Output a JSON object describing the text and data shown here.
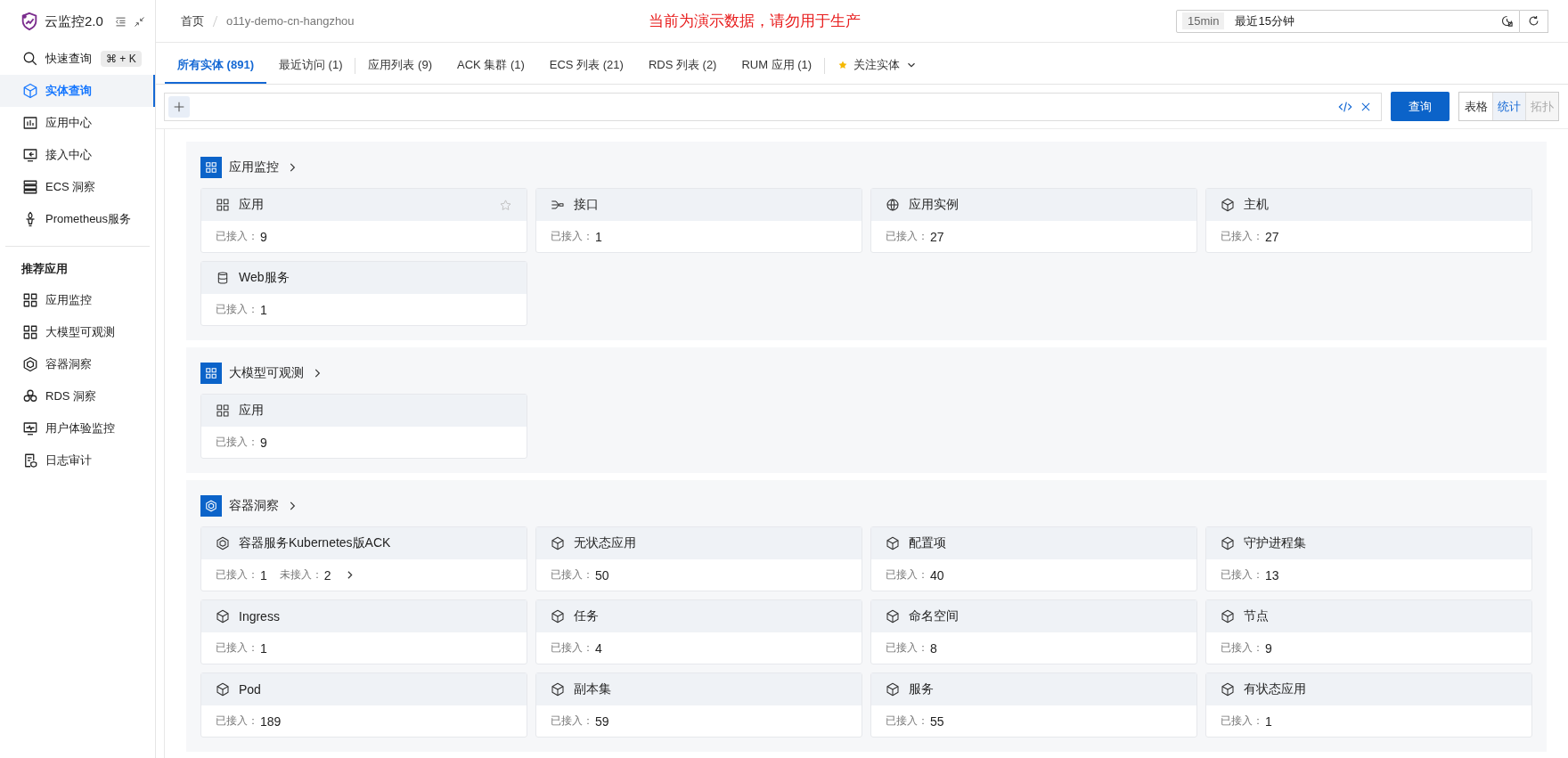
{
  "sidebar": {
    "logo_text": "云监控2.0",
    "items": [
      {
        "label": "快速查询",
        "kind": "search",
        "shortcut": "⌘ + K",
        "selected": false
      },
      {
        "label": "实体查询",
        "kind": "cube",
        "selected": true
      },
      {
        "label": "应用中心",
        "kind": "chart",
        "selected": false
      },
      {
        "label": "接入中心",
        "kind": "monitor-in",
        "selected": false
      },
      {
        "label": "ECS 洞察",
        "kind": "server",
        "selected": false
      },
      {
        "label": "Prometheus服务",
        "kind": "torch",
        "selected": false
      }
    ],
    "group_title": "推荐应用",
    "recommended": [
      {
        "label": "应用监控",
        "kind": "grid",
        "selected": false
      },
      {
        "label": "大模型可观测",
        "kind": "grid",
        "selected": false
      },
      {
        "label": "容器洞察",
        "kind": "hexagon",
        "selected": false
      },
      {
        "label": "RDS 洞察",
        "kind": "trio",
        "selected": false
      },
      {
        "label": "用户体验监控",
        "kind": "pulse-monitor",
        "selected": false
      },
      {
        "label": "日志审计",
        "kind": "log",
        "selected": false
      }
    ]
  },
  "breadcrumb": [
    "首页",
    "o11y-demo-cn-hangzhou"
  ],
  "notice": "当前为演示数据，请勿用于生产",
  "time_range": {
    "badge": "15min",
    "label": "最近15分钟"
  },
  "tabs": [
    {
      "label": "所有实体 (891)",
      "selected": true,
      "separator_before": false,
      "kind": "tab"
    },
    {
      "label": "最近访问 (1)",
      "selected": false,
      "separator_before": false,
      "kind": "tab"
    },
    {
      "label": "应用列表 (9)",
      "selected": false,
      "separator_before": true,
      "kind": "tab"
    },
    {
      "label": "ACK 集群 (1)",
      "selected": false,
      "separator_before": false,
      "kind": "tab"
    },
    {
      "label": "ECS 列表 (21)",
      "selected": false,
      "separator_before": false,
      "kind": "tab"
    },
    {
      "label": "RDS 列表 (2)",
      "selected": false,
      "separator_before": false,
      "kind": "tab"
    },
    {
      "label": "RUM 应用 (1)",
      "selected": false,
      "separator_before": false,
      "kind": "tab"
    },
    {
      "label": "关注实体",
      "selected": false,
      "separator_before": true,
      "kind": "favorites"
    }
  ],
  "query_button": "查询",
  "view_toggle": [
    {
      "label": "表格",
      "selected": false,
      "disabled": false
    },
    {
      "label": "统计",
      "selected": true,
      "disabled": false
    },
    {
      "label": "拓扑",
      "selected": false,
      "disabled": true
    }
  ],
  "sections": [
    {
      "title": "应用监控",
      "kind": "grid",
      "cards": [
        {
          "title": "应用",
          "kind": "grid",
          "starred": false,
          "stats": [
            {
              "label": "已接入：",
              "value": "9"
            }
          ]
        },
        {
          "title": "接口",
          "kind": "nodes",
          "stats": [
            {
              "label": "已接入：",
              "value": "1"
            }
          ]
        },
        {
          "title": "应用实例",
          "kind": "globe",
          "stats": [
            {
              "label": "已接入：",
              "value": "27"
            }
          ]
        },
        {
          "title": "主机",
          "kind": "cube",
          "stats": [
            {
              "label": "已接入：",
              "value": "27"
            }
          ]
        },
        {
          "title": "Web服务",
          "kind": "database",
          "stats": [
            {
              "label": "已接入：",
              "value": "1"
            }
          ]
        }
      ]
    },
    {
      "title": "大模型可观测",
      "kind": "grid",
      "cards": [
        {
          "title": "应用",
          "kind": "grid",
          "stats": [
            {
              "label": "已接入：",
              "value": "9"
            }
          ]
        }
      ]
    },
    {
      "title": "容器洞察",
      "kind": "hexagon",
      "cards": [
        {
          "title": "容器服务Kubernetes版ACK",
          "kind": "hexagon",
          "expandable": true,
          "stats": [
            {
              "label": "已接入：",
              "value": "1"
            },
            {
              "label": "未接入：",
              "value": "2"
            }
          ]
        },
        {
          "title": "无状态应用",
          "kind": "cube",
          "stats": [
            {
              "label": "已接入：",
              "value": "50"
            }
          ]
        },
        {
          "title": "配置项",
          "kind": "cube",
          "stats": [
            {
              "label": "已接入：",
              "value": "40"
            }
          ]
        },
        {
          "title": "守护进程集",
          "kind": "cube",
          "stats": [
            {
              "label": "已接入：",
              "value": "13"
            }
          ]
        },
        {
          "title": "Ingress",
          "kind": "cube",
          "stats": [
            {
              "label": "已接入：",
              "value": "1"
            }
          ]
        },
        {
          "title": "任务",
          "kind": "cube",
          "stats": [
            {
              "label": "已接入：",
              "value": "4"
            }
          ]
        },
        {
          "title": "命名空间",
          "kind": "cube",
          "stats": [
            {
              "label": "已接入：",
              "value": "8"
            }
          ]
        },
        {
          "title": "节点",
          "kind": "cube",
          "stats": [
            {
              "label": "已接入：",
              "value": "9"
            }
          ]
        },
        {
          "title": "Pod",
          "kind": "cube",
          "stats": [
            {
              "label": "已接入：",
              "value": "189"
            }
          ]
        },
        {
          "title": "副本集",
          "kind": "cube",
          "stats": [
            {
              "label": "已接入：",
              "value": "59"
            }
          ]
        },
        {
          "title": "服务",
          "kind": "cube",
          "stats": [
            {
              "label": "已接入：",
              "value": "55"
            }
          ]
        },
        {
          "title": "有状态应用",
          "kind": "cube",
          "stats": [
            {
              "label": "已接入：",
              "value": "1"
            }
          ]
        }
      ]
    }
  ]
}
